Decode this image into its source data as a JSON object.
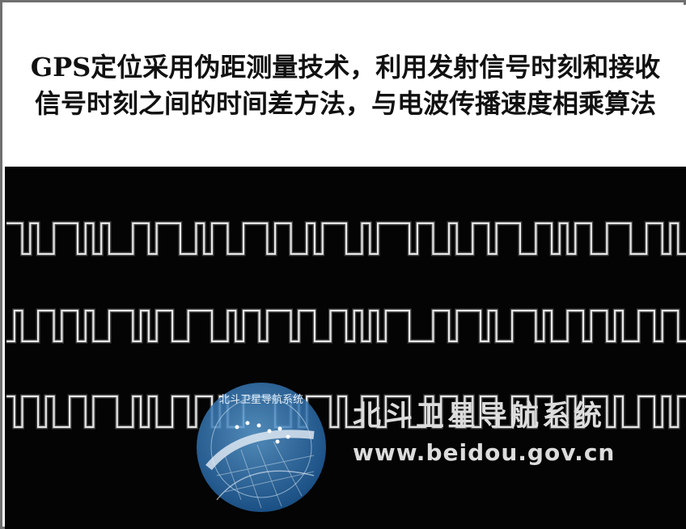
{
  "caption": {
    "text": "GPS定位采用伪距测量技术，利用发射信号时刻和接收信号时刻之间的时间差方法，与电波传播速度相乘算法"
  },
  "watermark": {
    "title": "北斗卫星导航系统",
    "url": "www.beidou.gov.cn",
    "emblem_ring_text": "北斗卫星导航系统",
    "emblem_icon": "beidou-emblem-icon"
  },
  "waveforms": {
    "count": 3,
    "row1": [
      1,
      1,
      0,
      1,
      0,
      0,
      1,
      1,
      1,
      0,
      1,
      0,
      1,
      0,
      0,
      0,
      1,
      1,
      0,
      1,
      1,
      1,
      0,
      0,
      1,
      0,
      1,
      1,
      0,
      0,
      1,
      1,
      1,
      0,
      1,
      1,
      0,
      0,
      1,
      0,
      1,
      1,
      1,
      0,
      0,
      1,
      0,
      1,
      1,
      1,
      1,
      0,
      1,
      1,
      0,
      0,
      1,
      0,
      0,
      1,
      1,
      0,
      1,
      1,
      1,
      0,
      0,
      1,
      1,
      0,
      1,
      0,
      1,
      1,
      0,
      0,
      1,
      1,
      1,
      0,
      0,
      1,
      1,
      0,
      1,
      0
    ],
    "row2": [
      0,
      1,
      0,
      0,
      1,
      1,
      0,
      1,
      1,
      0,
      1,
      0,
      0,
      1,
      1,
      1,
      0,
      1,
      0,
      1,
      1,
      0,
      0,
      1,
      1,
      1,
      0,
      0,
      1,
      0,
      1,
      1,
      0,
      1,
      1,
      1,
      0,
      1,
      1,
      0,
      0,
      1,
      1,
      0,
      1,
      0,
      1,
      0,
      1,
      1,
      1,
      0,
      0,
      0,
      1,
      1,
      0,
      1,
      1,
      1,
      0,
      1,
      0,
      0,
      1,
      1,
      1,
      0,
      1,
      0,
      0,
      1,
      1,
      0,
      1,
      1,
      0,
      1,
      0,
      0,
      1,
      1,
      0,
      1,
      1,
      0
    ],
    "row3": [
      1,
      0,
      1,
      1,
      0,
      1,
      0,
      0,
      1,
      1,
      0,
      1,
      1,
      1,
      0,
      0,
      1,
      0,
      1,
      0,
      0,
      1,
      1,
      0,
      1,
      1,
      0,
      1,
      0,
      0,
      1,
      1,
      1,
      1,
      0,
      0,
      1,
      0,
      1,
      1,
      1,
      0,
      1,
      0,
      0,
      1,
      1,
      0,
      1,
      1,
      1,
      0,
      0,
      1,
      0,
      1,
      1,
      0,
      1,
      0,
      1,
      1,
      0,
      0,
      1,
      1,
      0,
      1,
      1,
      0,
      0,
      1,
      0,
      1,
      1,
      1,
      0,
      1,
      0,
      0,
      1,
      1,
      0,
      1,
      0,
      1
    ]
  }
}
